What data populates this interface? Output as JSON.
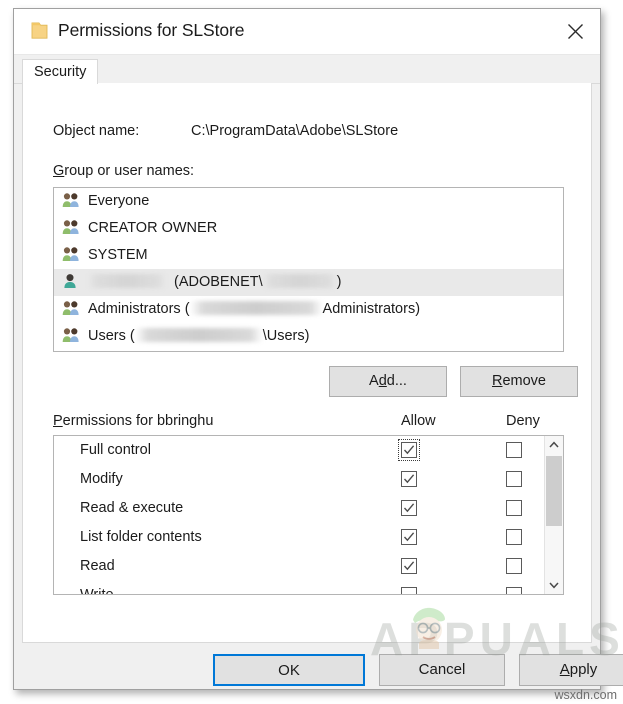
{
  "window": {
    "title": "Permissions for SLStore",
    "folder_icon": "folder-icon",
    "close_icon": "close-icon"
  },
  "tabs": [
    {
      "label": "Security",
      "active": true
    }
  ],
  "security_tab": {
    "object_name_label": "Object name:",
    "object_name_value": "C:\\ProgramData\\Adobe\\SLStore",
    "group_names_label": "Group or user names:",
    "group_list": [
      {
        "icon": "group-users-icon",
        "name": "Everyone",
        "selected": false,
        "redacted": false
      },
      {
        "icon": "group-users-icon",
        "name": "CREATOR OWNER",
        "selected": false,
        "redacted": false
      },
      {
        "icon": "group-users-icon",
        "name": "SYSTEM",
        "selected": false,
        "redacted": false
      },
      {
        "icon": "single-user-icon",
        "name": "(ADOBENET\\",
        "selected": true,
        "redacted": true,
        "prefix_redacted": true,
        "suffix": ")"
      },
      {
        "icon": "group-users-icon",
        "name": "Administrators (",
        "selected": false,
        "redacted": true,
        "suffix": "Administrators)"
      },
      {
        "icon": "group-users-icon",
        "name": "Users (",
        "selected": false,
        "redacted": true,
        "suffix": "\\Users)"
      }
    ],
    "add_button": "Add...",
    "add_button_accel": "d",
    "remove_button": "Remove",
    "remove_button_accel": "R",
    "permissions_header": "Permissions for bbringhu",
    "permissions_header_accel": "P",
    "allow_column": "Allow",
    "deny_column": "Deny",
    "permissions": [
      {
        "name": "Full control",
        "allow": true,
        "deny": false,
        "focused": true
      },
      {
        "name": "Modify",
        "allow": true,
        "deny": false,
        "focused": false
      },
      {
        "name": "Read & execute",
        "allow": true,
        "deny": false,
        "focused": false
      },
      {
        "name": "List folder contents",
        "allow": true,
        "deny": false,
        "focused": false
      },
      {
        "name": "Read",
        "allow": true,
        "deny": false,
        "focused": false
      },
      {
        "name": "Write",
        "allow": false,
        "deny": false,
        "focused": false
      }
    ],
    "scrollbar": {
      "up_icon": "chevron-up-icon",
      "down_icon": "chevron-down-icon"
    }
  },
  "footer": {
    "ok_button": "OK",
    "cancel_button": "Cancel",
    "apply_button": "Apply",
    "apply_button_accel": "A"
  },
  "overlays": {
    "watermark_text": "APPUALS",
    "site_credit": "wsxdn.com"
  },
  "colors": {
    "accent_focus": "#0078d7",
    "dialog_bg": "#f0f0f0",
    "button_bg": "#e1e1e1",
    "selection_bg": "#e9e9e9",
    "folder_yellow": "#f5cf6b"
  }
}
